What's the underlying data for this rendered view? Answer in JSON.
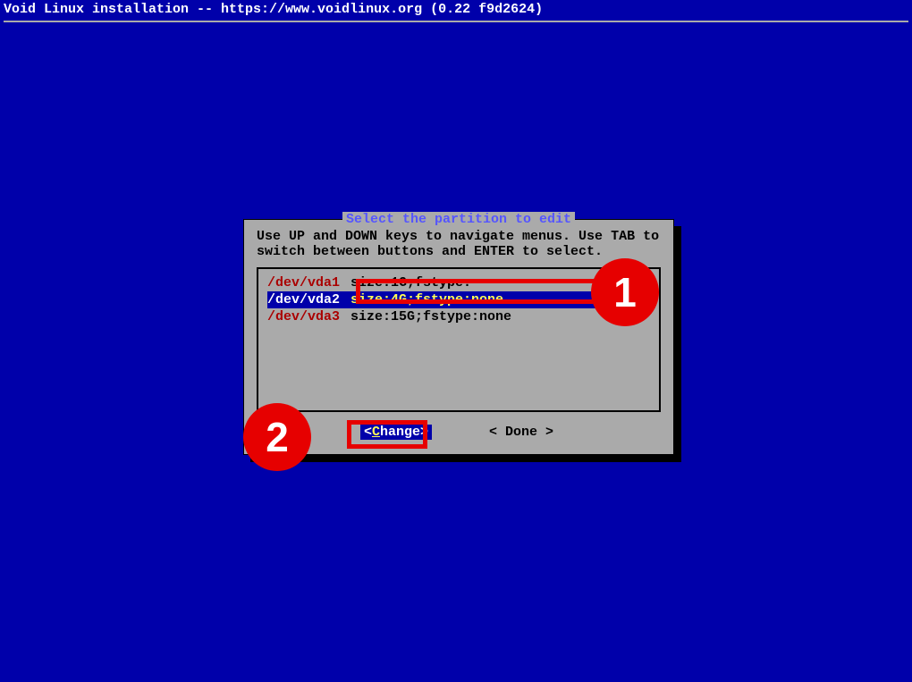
{
  "header": {
    "title": "Void Linux installation -- https://www.voidlinux.org (0.22 f9d2624)"
  },
  "dialog": {
    "title": " Select the partition to edit ",
    "instructions_line1": "Use UP and DOWN keys to navigate menus. Use TAB to",
    "instructions_line2": "switch between buttons and ENTER to select.",
    "items": [
      {
        "dev": "/dev/vda1",
        "desc": "size:1G;fstype:"
      },
      {
        "dev": "/dev/vda2",
        "desc": "size:4G;fstype:none"
      },
      {
        "dev": "/dev/vda3",
        "desc": "size:15G;fstype:none"
      }
    ],
    "buttons": {
      "change_hotkey": "C",
      "change_rest": "hange",
      "done": "< Done >"
    }
  },
  "annotations": {
    "n1": "1",
    "n2": "2"
  }
}
